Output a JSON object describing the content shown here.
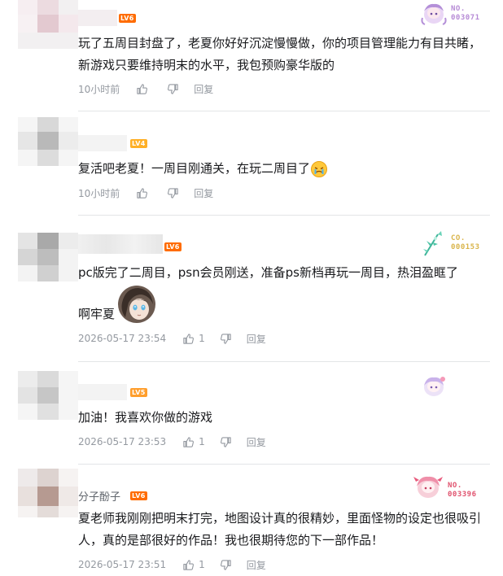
{
  "comments": [
    {
      "username": "",
      "level": "LV6",
      "text": "玩了五周目封盘了，老夏你好好沉淀慢慢做，你的项目管理能力有目共睹，新游戏只要维持明末的水平，我包预购豪华版的",
      "time": "10小时前",
      "like_count": "",
      "reply_label": "回复",
      "fan_label": "NO.",
      "fan_number": "003071",
      "fan_color": "#b68ad6"
    },
    {
      "username": "",
      "level": "LV4",
      "text": "复活吧老夏！一周目刚通关，在玩二周目了",
      "time": "10小时前",
      "like_count": "",
      "reply_label": "回复"
    },
    {
      "username": "",
      "level": "LV6",
      "text_line1": "pc版完了二周目，psn会员刚送，准备ps新档再玩一周目，热泪盈眶了",
      "text_line2": "啊牢夏",
      "time": "2026-05-17 23:54",
      "like_count": "1",
      "reply_label": "回复",
      "fan_label": "CO.",
      "fan_number": "000153",
      "fan_color": "#d9b44a"
    },
    {
      "username": "",
      "level": "LV5",
      "text": "加油！我喜欢你做的游戏",
      "time": "2026-05-17 23:53",
      "like_count": "1",
      "reply_label": "回复"
    },
    {
      "username": "分子酚子",
      "level": "LV6",
      "text": "夏老师我刚刚把明末打完，地图设计真的很精妙，里面怪物的设定也很吸引人，真的是部很好的作品！我也很期待您的下一部作品！",
      "time": "2026-05-17 23:51",
      "like_count": "1",
      "reply_label": "回复",
      "fan_label": "NO.",
      "fan_number": "003396",
      "fan_color": "#e0526e"
    }
  ],
  "colors": {
    "text": "#18191c",
    "meta": "#9499a0",
    "divider": "#e3e5e7"
  }
}
